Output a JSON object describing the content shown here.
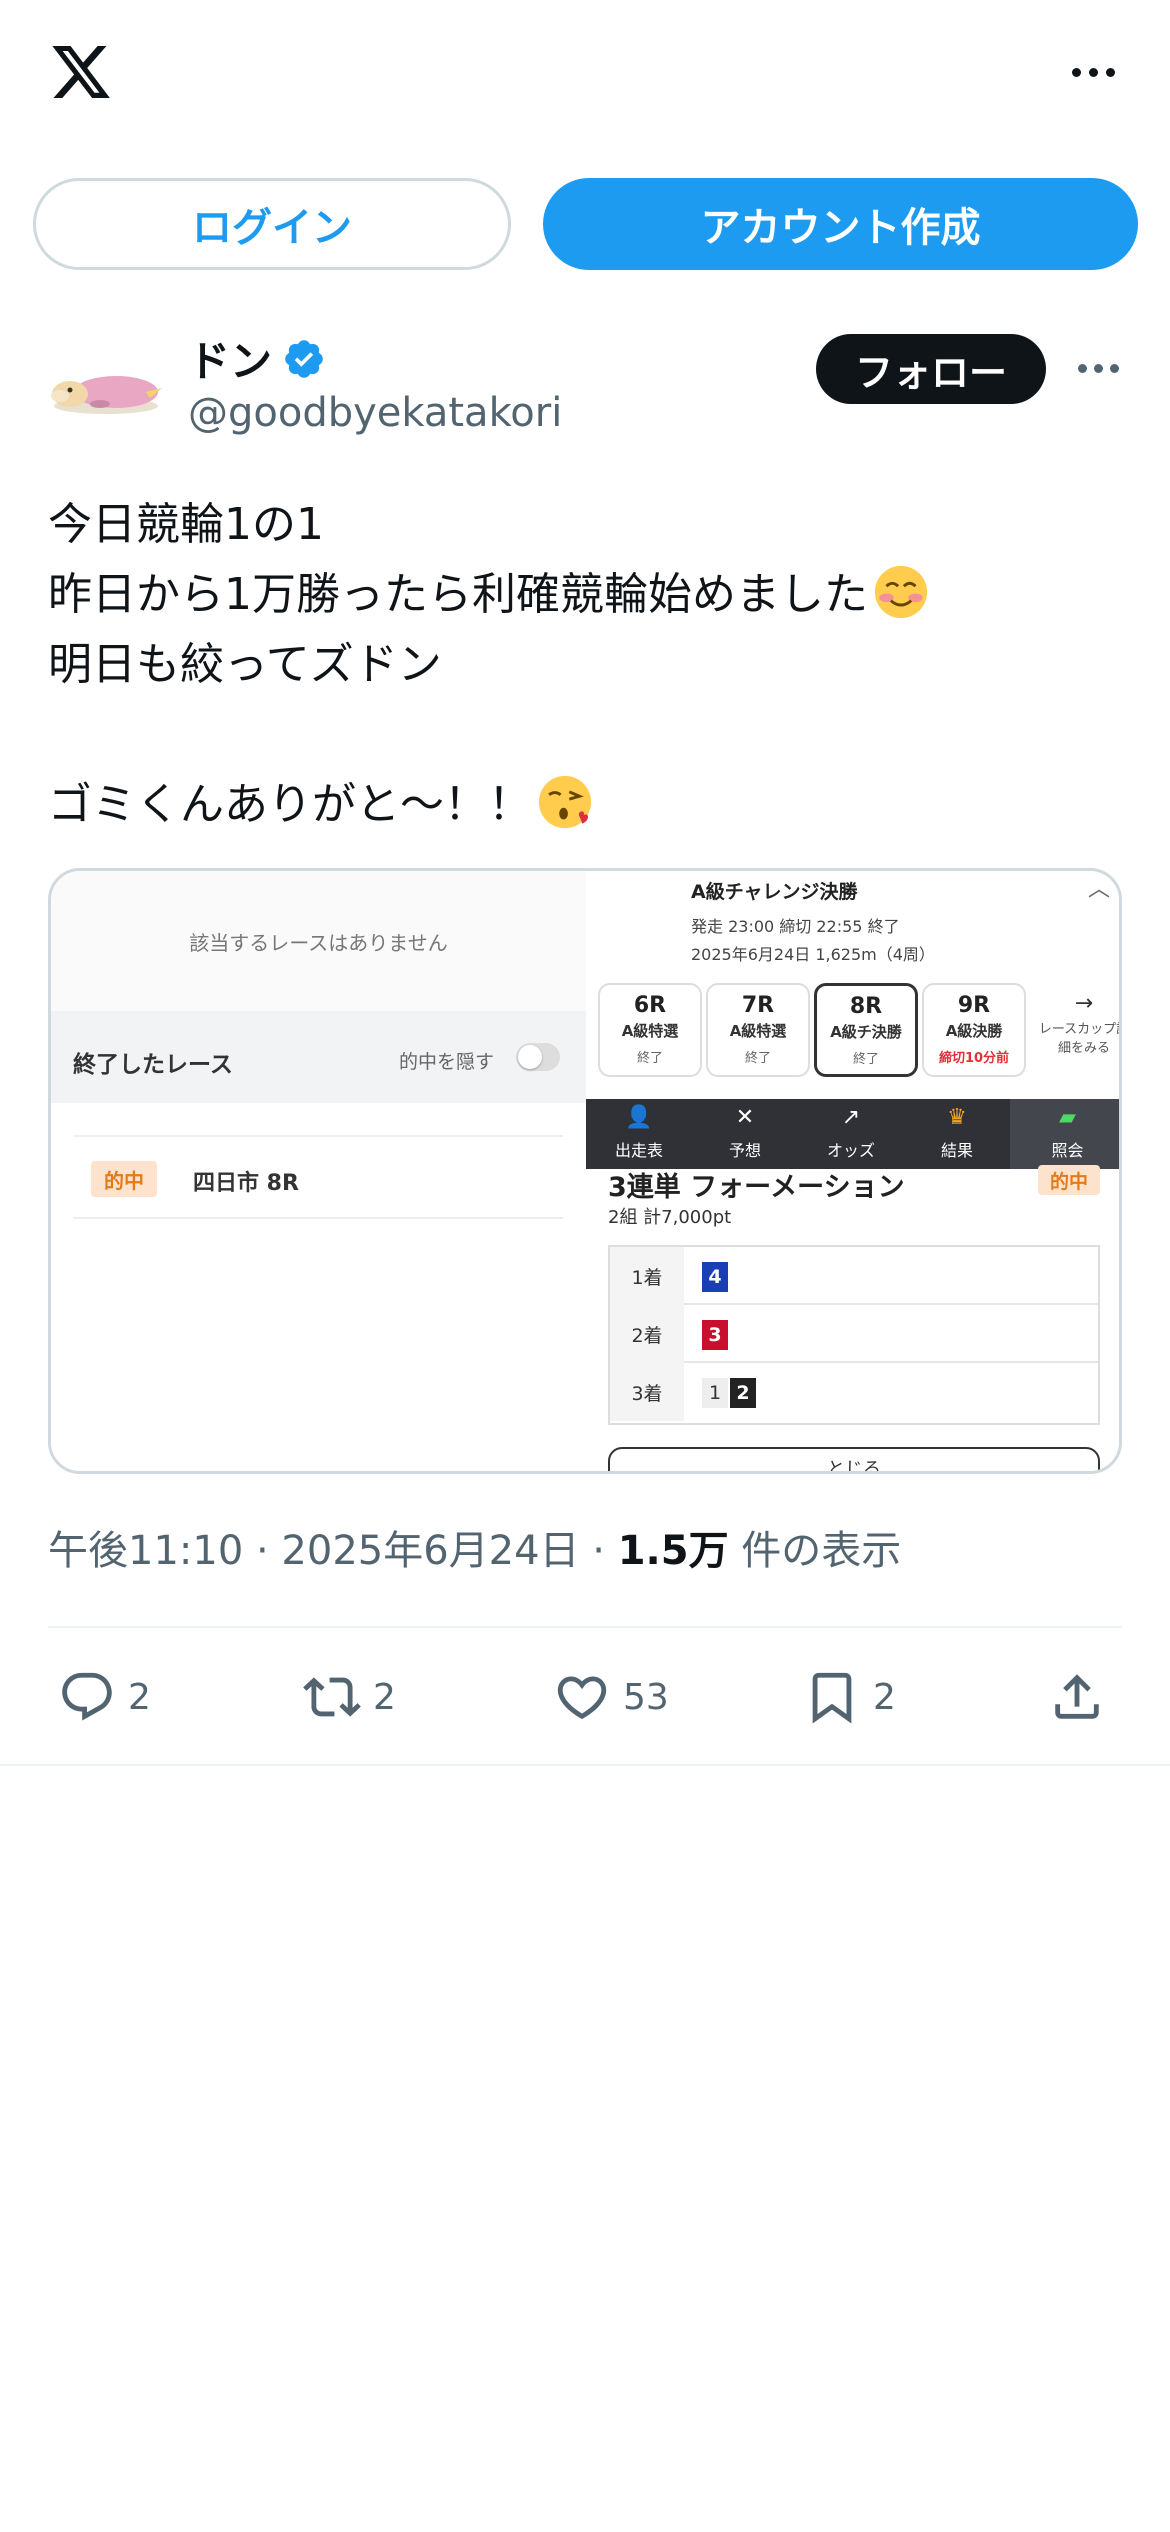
{
  "topbar": {
    "logo_icon": "x-logo-icon",
    "more_icon": "more-horizontal-icon"
  },
  "auth": {
    "login_label": "ログイン",
    "signup_label": "アカウント作成"
  },
  "author": {
    "name": "ドン",
    "handle": "@goodbyekatakori",
    "follow_label": "フォロー",
    "verified_icon": "verified-badge-icon",
    "accent": "#1d9bf0"
  },
  "tweet": {
    "lines": [
      "今日競輪1の1",
      "昨日から1万勝ったら利確競輪始めました",
      "明日も絞ってズドン",
      "",
      "ゴミくんありがと〜！！"
    ]
  },
  "media": {
    "left": {
      "empty_text": "該当するレースはありません",
      "section_title": "終了したレース",
      "hide_hits_label": "的中を隠す",
      "row_badge": "的中",
      "row_race": "四日市 8R"
    },
    "right": {
      "title": "A級チャレンジ決勝",
      "meta1": "発走 23:00 締切 22:55  終了",
      "meta2": "2025年6月24日 1,625m（4周）",
      "tabs": [
        {
          "num": "6R",
          "cls": "A級特選",
          "status": "終了"
        },
        {
          "num": "7R",
          "cls": "A級特選",
          "status": "終了"
        },
        {
          "num": "8R",
          "cls": "A級チ決勝",
          "status": "終了"
        },
        {
          "num": "9R",
          "cls": "A級決勝",
          "status": "締切10分前"
        }
      ],
      "more_tab": {
        "arrow": "→",
        "label": "レースカップ詳細をみる"
      },
      "nav": [
        {
          "icon": "entries-icon",
          "label": "出走表"
        },
        {
          "icon": "prediction-icon",
          "label": "予想"
        },
        {
          "icon": "odds-icon",
          "label": "オッズ"
        },
        {
          "icon": "trophy-icon",
          "label": "結果"
        },
        {
          "icon": "ticket-icon",
          "label": "照会"
        }
      ],
      "bet_type": "3連単 フォーメーション",
      "bet_badge": "的中",
      "bet_summary": "2組 計7,000pt",
      "rows": [
        {
          "place": "1着",
          "nums": [
            "4"
          ]
        },
        {
          "place": "2着",
          "nums": [
            "3"
          ]
        },
        {
          "place": "3着",
          "nums": [
            "1",
            "2"
          ]
        }
      ],
      "close_label": "とじる"
    }
  },
  "meta": {
    "time": "午後11:10 · 2025年6月24日 · ",
    "views": "1.5万",
    "views_suffix": " 件の表示"
  },
  "actions": {
    "reply_count": "2",
    "retweet_count": "2",
    "like_count": "53",
    "bookmark_count": "2",
    "icons": [
      "reply-icon",
      "retweet-icon",
      "like-icon",
      "bookmark-icon",
      "share-icon"
    ]
  }
}
